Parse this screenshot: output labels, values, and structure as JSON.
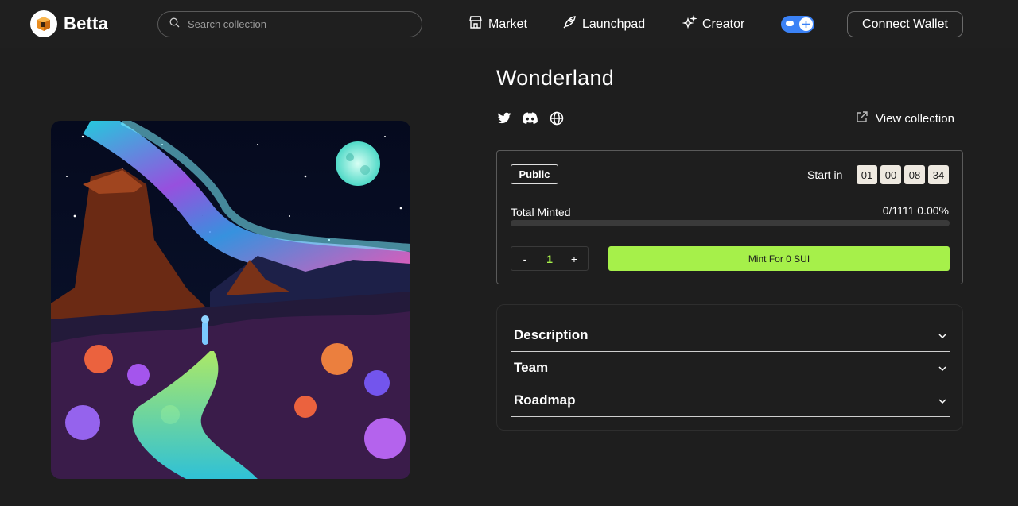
{
  "header": {
    "brand": "Betta",
    "search": {
      "placeholder": "Search collection",
      "value": ""
    },
    "nav": [
      {
        "label": "Market",
        "icon": "store-icon"
      },
      {
        "label": "Launchpad",
        "icon": "rocket-icon"
      },
      {
        "label": "Creator",
        "icon": "sparkle-icon"
      }
    ],
    "network_toggle": {
      "state": "on",
      "color": "#3b82f6"
    },
    "connect_label": "Connect Wallet"
  },
  "collection": {
    "title": "Wonderland",
    "socials": [
      "twitter-icon",
      "discord-icon",
      "globe-icon"
    ],
    "view_collection_label": "View collection"
  },
  "mint": {
    "phase_badge": "Public",
    "start_label": "Start in",
    "countdown": [
      "01",
      "00",
      "08",
      "34"
    ],
    "total_minted_label": "Total Minted",
    "total_minted_value": "0/1111 0.00%",
    "progress_fraction": 0.0,
    "quantity": "1",
    "decrement_label": "-",
    "increment_label": "+",
    "mint_button_label": "Mint For 0 SUI",
    "accent_color": "#a6f04a"
  },
  "accordion": [
    {
      "label": "Description"
    },
    {
      "label": "Team"
    },
    {
      "label": "Roadmap"
    }
  ]
}
